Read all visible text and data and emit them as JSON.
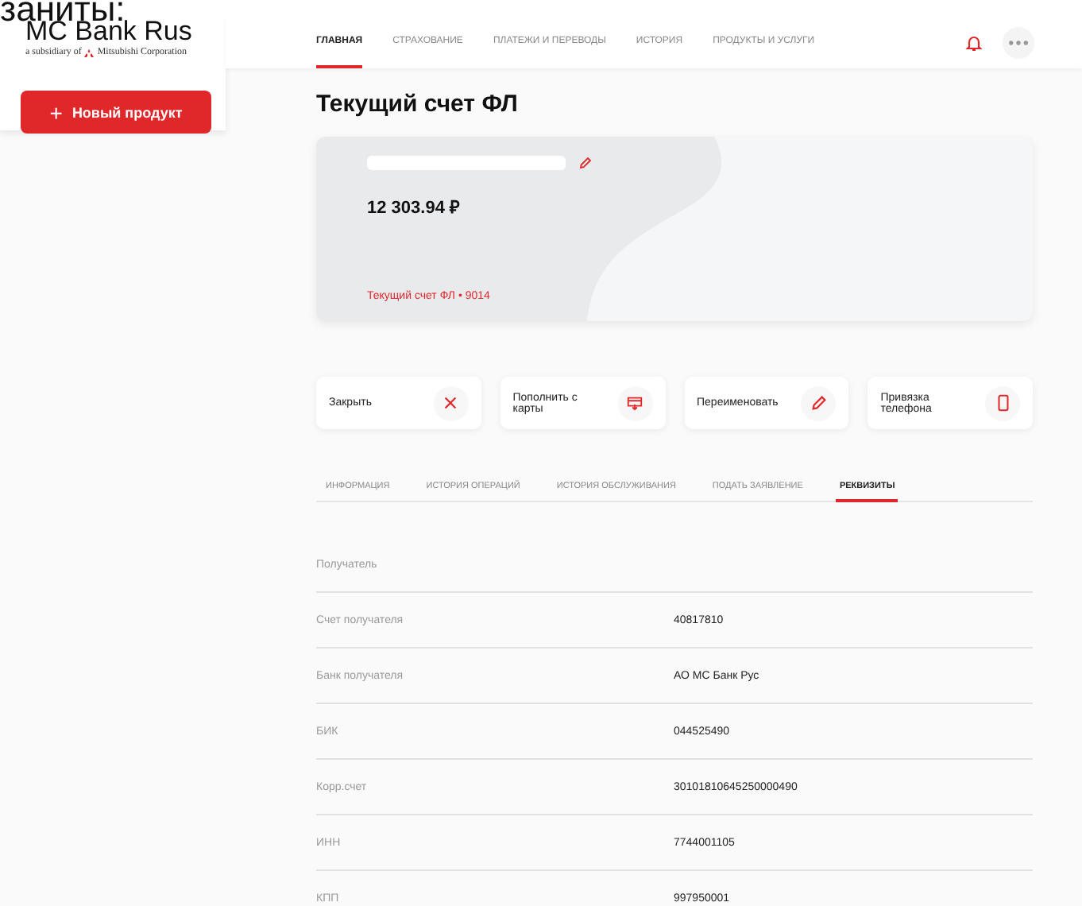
{
  "caption_fragment": "заниты:",
  "logo": {
    "name": "MC Bank Rus",
    "subtitle": "a subsidiary of",
    "parent": "Mitsubishi Corporation"
  },
  "new_product_button": {
    "icon": "+",
    "label": "Новый продукт"
  },
  "nav": [
    {
      "label": "ГЛАВНАЯ",
      "selected": true
    },
    {
      "label": "СТРАХОВАНИЕ",
      "selected": false
    },
    {
      "label": "ПЛАТЕЖИ И ПЕРЕВОДЫ",
      "selected": false
    },
    {
      "label": "ИСТОРИЯ",
      "selected": false
    },
    {
      "label": "ПРОДУКТЫ И УСЛУГИ",
      "selected": false
    }
  ],
  "page_title": "Текущий счет ФЛ",
  "account_card": {
    "name_redacted": true,
    "balance": "12 303.94 ₽",
    "account_label": "Текущий счет ФЛ • 9014"
  },
  "actions": [
    {
      "label": "Закрыть",
      "kind": "close"
    },
    {
      "label": "Пополнить с карты",
      "kind": "card"
    },
    {
      "label": "Переименовать",
      "kind": "pencil"
    },
    {
      "label": "Привязка телефона",
      "kind": "phone"
    }
  ],
  "tabs": [
    {
      "label": "ИНФОРМАЦИЯ",
      "selected": false
    },
    {
      "label": "ИСТОРИЯ ОПЕРАЦИЙ",
      "selected": false
    },
    {
      "label": "ИСТОРИЯ ОБСЛУЖИВАНИЯ",
      "selected": false
    },
    {
      "label": "ПОДАТЬ ЗАЯВЛЕНИЕ",
      "selected": false
    },
    {
      "label": "РЕКВИЗИТЫ",
      "selected": true
    }
  ],
  "details": [
    {
      "label": "Получатель"
    },
    {
      "label": "Счет получателя",
      "value": "40817810"
    },
    {
      "label": "Банк получателя",
      "value": "АО МС Банк Рус"
    },
    {
      "label": "БИК",
      "value": "044525490"
    },
    {
      "label": "Корр.счет",
      "value": "30101810645250000490"
    },
    {
      "label": "ИНН",
      "value": "7744001105"
    },
    {
      "label": "КПП",
      "value": "997950001"
    }
  ]
}
